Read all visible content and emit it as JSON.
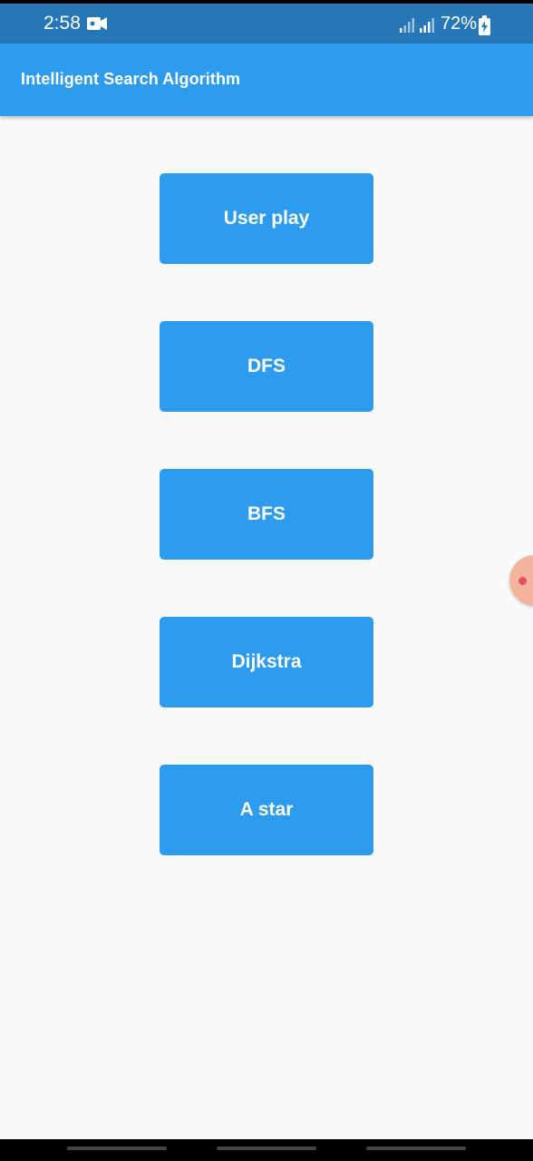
{
  "status_bar": {
    "time": "2:58",
    "battery_percent": "72%"
  },
  "app_bar": {
    "title": "Intelligent Search Algorithm",
    "color": "#2d9bee"
  },
  "menu": {
    "buttons": [
      {
        "label": "User play"
      },
      {
        "label": "DFS"
      },
      {
        "label": "BFS"
      },
      {
        "label": "Dijkstra"
      },
      {
        "label": "A star"
      }
    ]
  },
  "colors": {
    "status_bar": "#2677b8",
    "primary": "#2d9bee",
    "background": "#fafafa"
  }
}
